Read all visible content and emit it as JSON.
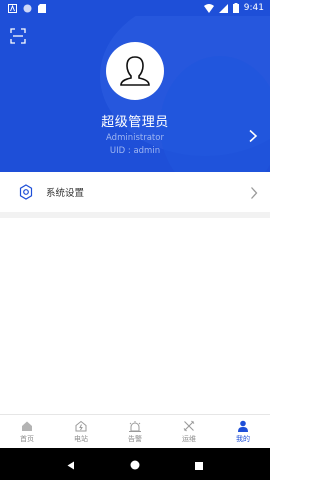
{
  "status_bar": {
    "time": "9:41"
  },
  "profile": {
    "name": "超级管理员",
    "role": "Administrator",
    "uid": "UID : admin"
  },
  "menu": {
    "settings_label": "系统设置"
  },
  "bottom_nav": {
    "items": [
      {
        "label": "首页",
        "icon": "home-icon",
        "active": false
      },
      {
        "label": "电站",
        "icon": "station-icon",
        "active": false
      },
      {
        "label": "告警",
        "icon": "alarm-icon",
        "active": false
      },
      {
        "label": "运维",
        "icon": "tools-icon",
        "active": false
      },
      {
        "label": "我的",
        "icon": "person-icon",
        "active": true
      }
    ]
  },
  "colors": {
    "primary": "#1e4fd8",
    "inactive": "#8c8c8c"
  }
}
